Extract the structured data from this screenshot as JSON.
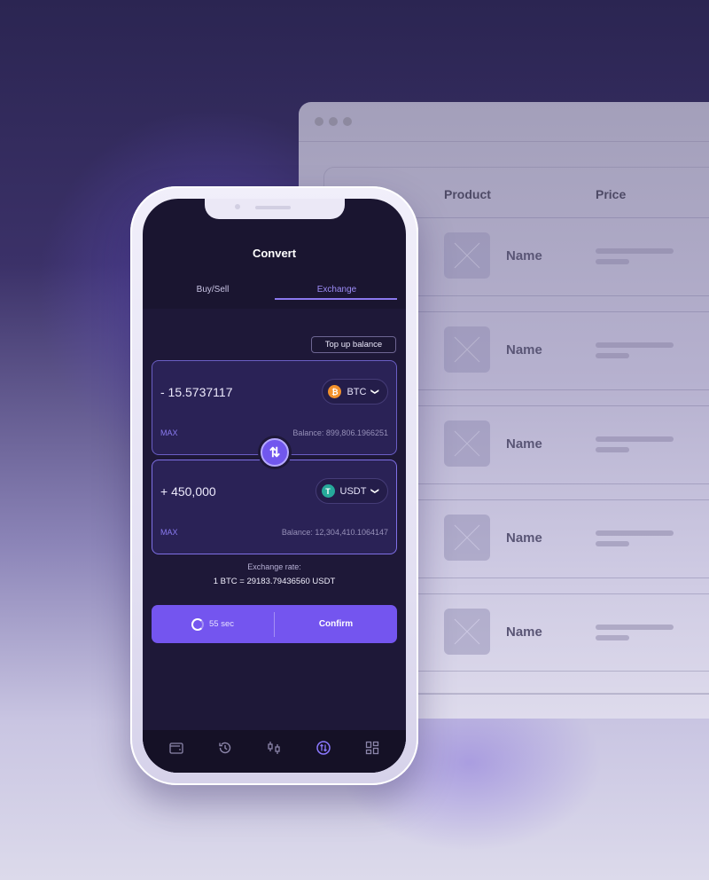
{
  "browser": {
    "window_dots": 3,
    "table": {
      "columns": [
        "Product",
        "Price"
      ],
      "rows": [
        {
          "name": "Name"
        },
        {
          "name": "Name"
        },
        {
          "name": "Name"
        },
        {
          "name": "Name"
        },
        {
          "name": "Name"
        }
      ]
    }
  },
  "phone": {
    "title": "Convert",
    "tabs": [
      {
        "label": "Buy/Sell",
        "active": false
      },
      {
        "label": "Exchange",
        "active": true
      }
    ],
    "top_up_label": "Top up balance",
    "from": {
      "amount": "- 15.5737117",
      "currency": "BTC",
      "currency_icon": "bitcoin-icon",
      "max_label": "MAX",
      "balance": "Balance: 899,806.1966251"
    },
    "to": {
      "amount": "+ 450,000",
      "currency": "USDT",
      "currency_icon": "tether-icon",
      "max_label": "MAX",
      "balance": "Balance: 12,304,410.1064147"
    },
    "swap_icon": "swap-arrows-icon",
    "exchange_rate_label": "Exchange rate:",
    "exchange_rate_value": "1 BTC = 29183.79436560 USDT",
    "timer_label": "55 sec",
    "confirm_label": "Confirm",
    "nav": [
      {
        "icon": "wallet-icon",
        "active": false
      },
      {
        "icon": "history-icon",
        "active": false
      },
      {
        "icon": "candles-chart-icon",
        "active": false
      },
      {
        "icon": "exchange-icon",
        "active": true
      },
      {
        "icon": "dashboard-grid-icon",
        "active": false
      }
    ],
    "colors": {
      "accent": "#7455ef",
      "active_tab": "#9d8cf7",
      "btc": "#f2912c",
      "usdt": "#26a99a",
      "screen_bg": "#1a1530"
    }
  }
}
